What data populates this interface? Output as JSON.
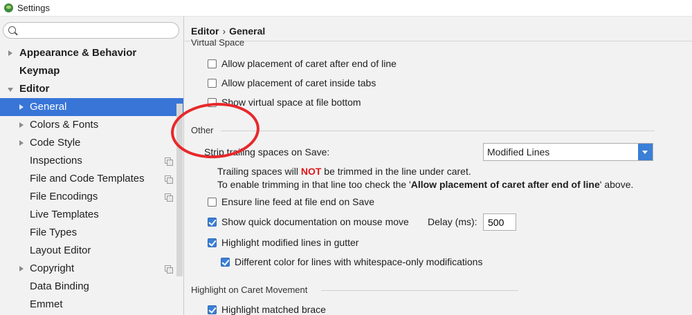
{
  "window": {
    "title": "Settings"
  },
  "search": {
    "placeholder": "",
    "value": ""
  },
  "sidebar": {
    "items": [
      {
        "label": "Appearance & Behavior"
      },
      {
        "label": "Keymap"
      },
      {
        "label": "Editor"
      },
      {
        "label": "General"
      },
      {
        "label": "Colors & Fonts"
      },
      {
        "label": "Code Style"
      },
      {
        "label": "Inspections"
      },
      {
        "label": "File and Code Templates"
      },
      {
        "label": "File Encodings"
      },
      {
        "label": "Live Templates"
      },
      {
        "label": "File Types"
      },
      {
        "label": "Layout Editor"
      },
      {
        "label": "Copyright"
      },
      {
        "label": "Data Binding"
      },
      {
        "label": "Emmet"
      }
    ]
  },
  "breadcrumb": {
    "parent": "Editor",
    "separator": "›",
    "current": "General"
  },
  "virtual_space": {
    "title": "Virtual Space",
    "options": [
      {
        "label": "Allow placement of caret after end of line",
        "checked": false
      },
      {
        "label": "Allow placement of caret inside tabs",
        "checked": false
      },
      {
        "label": "Show virtual space at file bottom",
        "checked": false
      }
    ]
  },
  "other": {
    "title": "Other",
    "strip_label": "Strip trailing spaces on Save:",
    "strip_value": "Modified Lines",
    "hint1_a": "Trailing spaces will ",
    "hint1_b": "NOT",
    "hint1_c": " be trimmed in the line under caret.",
    "hint2_a": "To enable trimming in that line too check the '",
    "hint2_b": "Allow placement of caret after end of line",
    "hint2_c": "' above.",
    "ensure_line_feed": {
      "label": "Ensure line feed at file end on Save",
      "checked": false
    },
    "quick_doc": {
      "label": "Show quick documentation on mouse move",
      "checked": true
    },
    "delay_label": "Delay (ms):",
    "delay_value": "500",
    "highlight_modified": {
      "label": "Highlight modified lines in gutter",
      "checked": true
    },
    "different_color": {
      "label": "Different color for lines with whitespace-only modifications",
      "checked": true
    }
  },
  "caret_movement": {
    "title": "Highlight on Caret Movement",
    "matched_brace": {
      "label": "Highlight matched brace",
      "checked": true
    }
  },
  "colors": {
    "selection": "#3875d7",
    "accent": "#3b7fd6",
    "annotation": "#e8282b",
    "not_red": "#e3151a"
  }
}
